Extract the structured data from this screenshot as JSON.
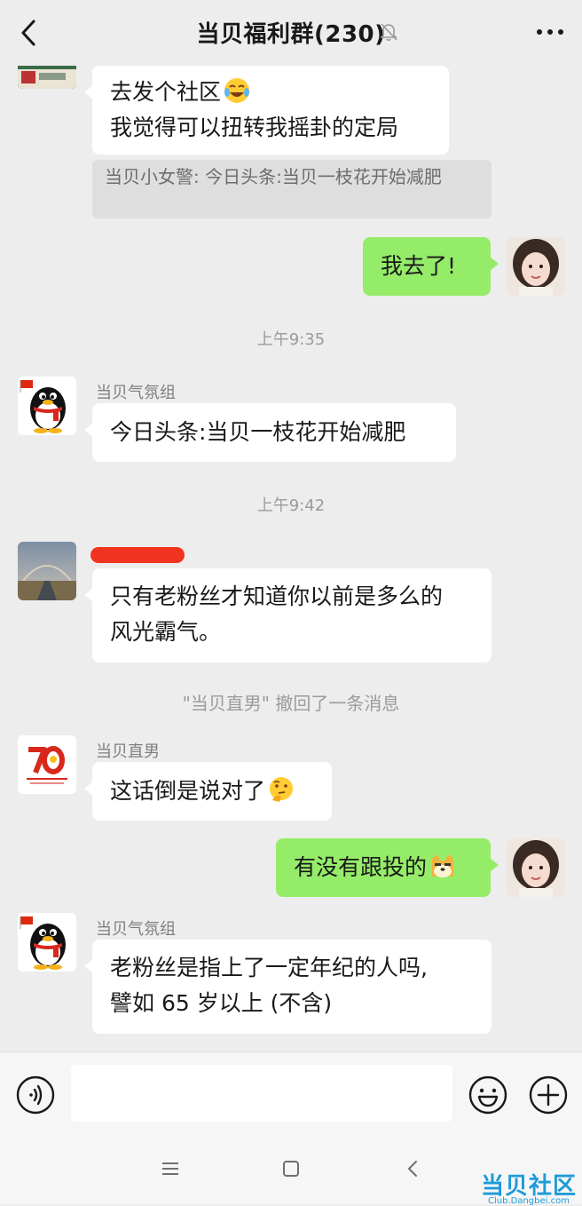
{
  "header": {
    "title": "当贝福利群(230)",
    "back_icon": "chevron-left-icon",
    "mute_icon": "bell-muted-icon",
    "more_icon": "more-dots-icon"
  },
  "messages": {
    "m1": {
      "line1": "去发个社区",
      "line2": "我觉得可以扭转我摇卦的定局",
      "emoji": "laughing-tears-emoji"
    },
    "quote": {
      "text": "当贝小女警: 今日头条:当贝一枝花开始减肥"
    },
    "m2": {
      "text": "我去了!"
    },
    "time1": "上午9:35",
    "m3": {
      "sender": "当贝气氛组",
      "text": "今日头条:当贝一枝花开始减肥"
    },
    "time2": "上午9:42",
    "m4": {
      "line1": "只有老粉丝才知道你以前是多么的",
      "line2": "风光霸气。"
    },
    "system": "\"当贝直男\" 撤回了一条消息",
    "m5": {
      "sender": "当贝直男",
      "text": "这话倒是说对了",
      "emoji": "thinking-emoji"
    },
    "m6": {
      "text": "有没有跟投的",
      "emoji": "doge-emoji"
    },
    "m7": {
      "sender": "当贝气氛组",
      "line1": "老粉丝是指上了一定年纪的人吗,",
      "line2": "譬如 65 岁以上 (不含)"
    }
  },
  "input": {
    "value": "",
    "placeholder": ""
  },
  "watermark": {
    "main": "当贝社区",
    "sub": "Club.Dangbei.com"
  },
  "colors": {
    "my_bubble": "#95ec69",
    "other_bubble": "#ffffff",
    "background": "#ededed",
    "watermark": "#1d9bd8"
  }
}
